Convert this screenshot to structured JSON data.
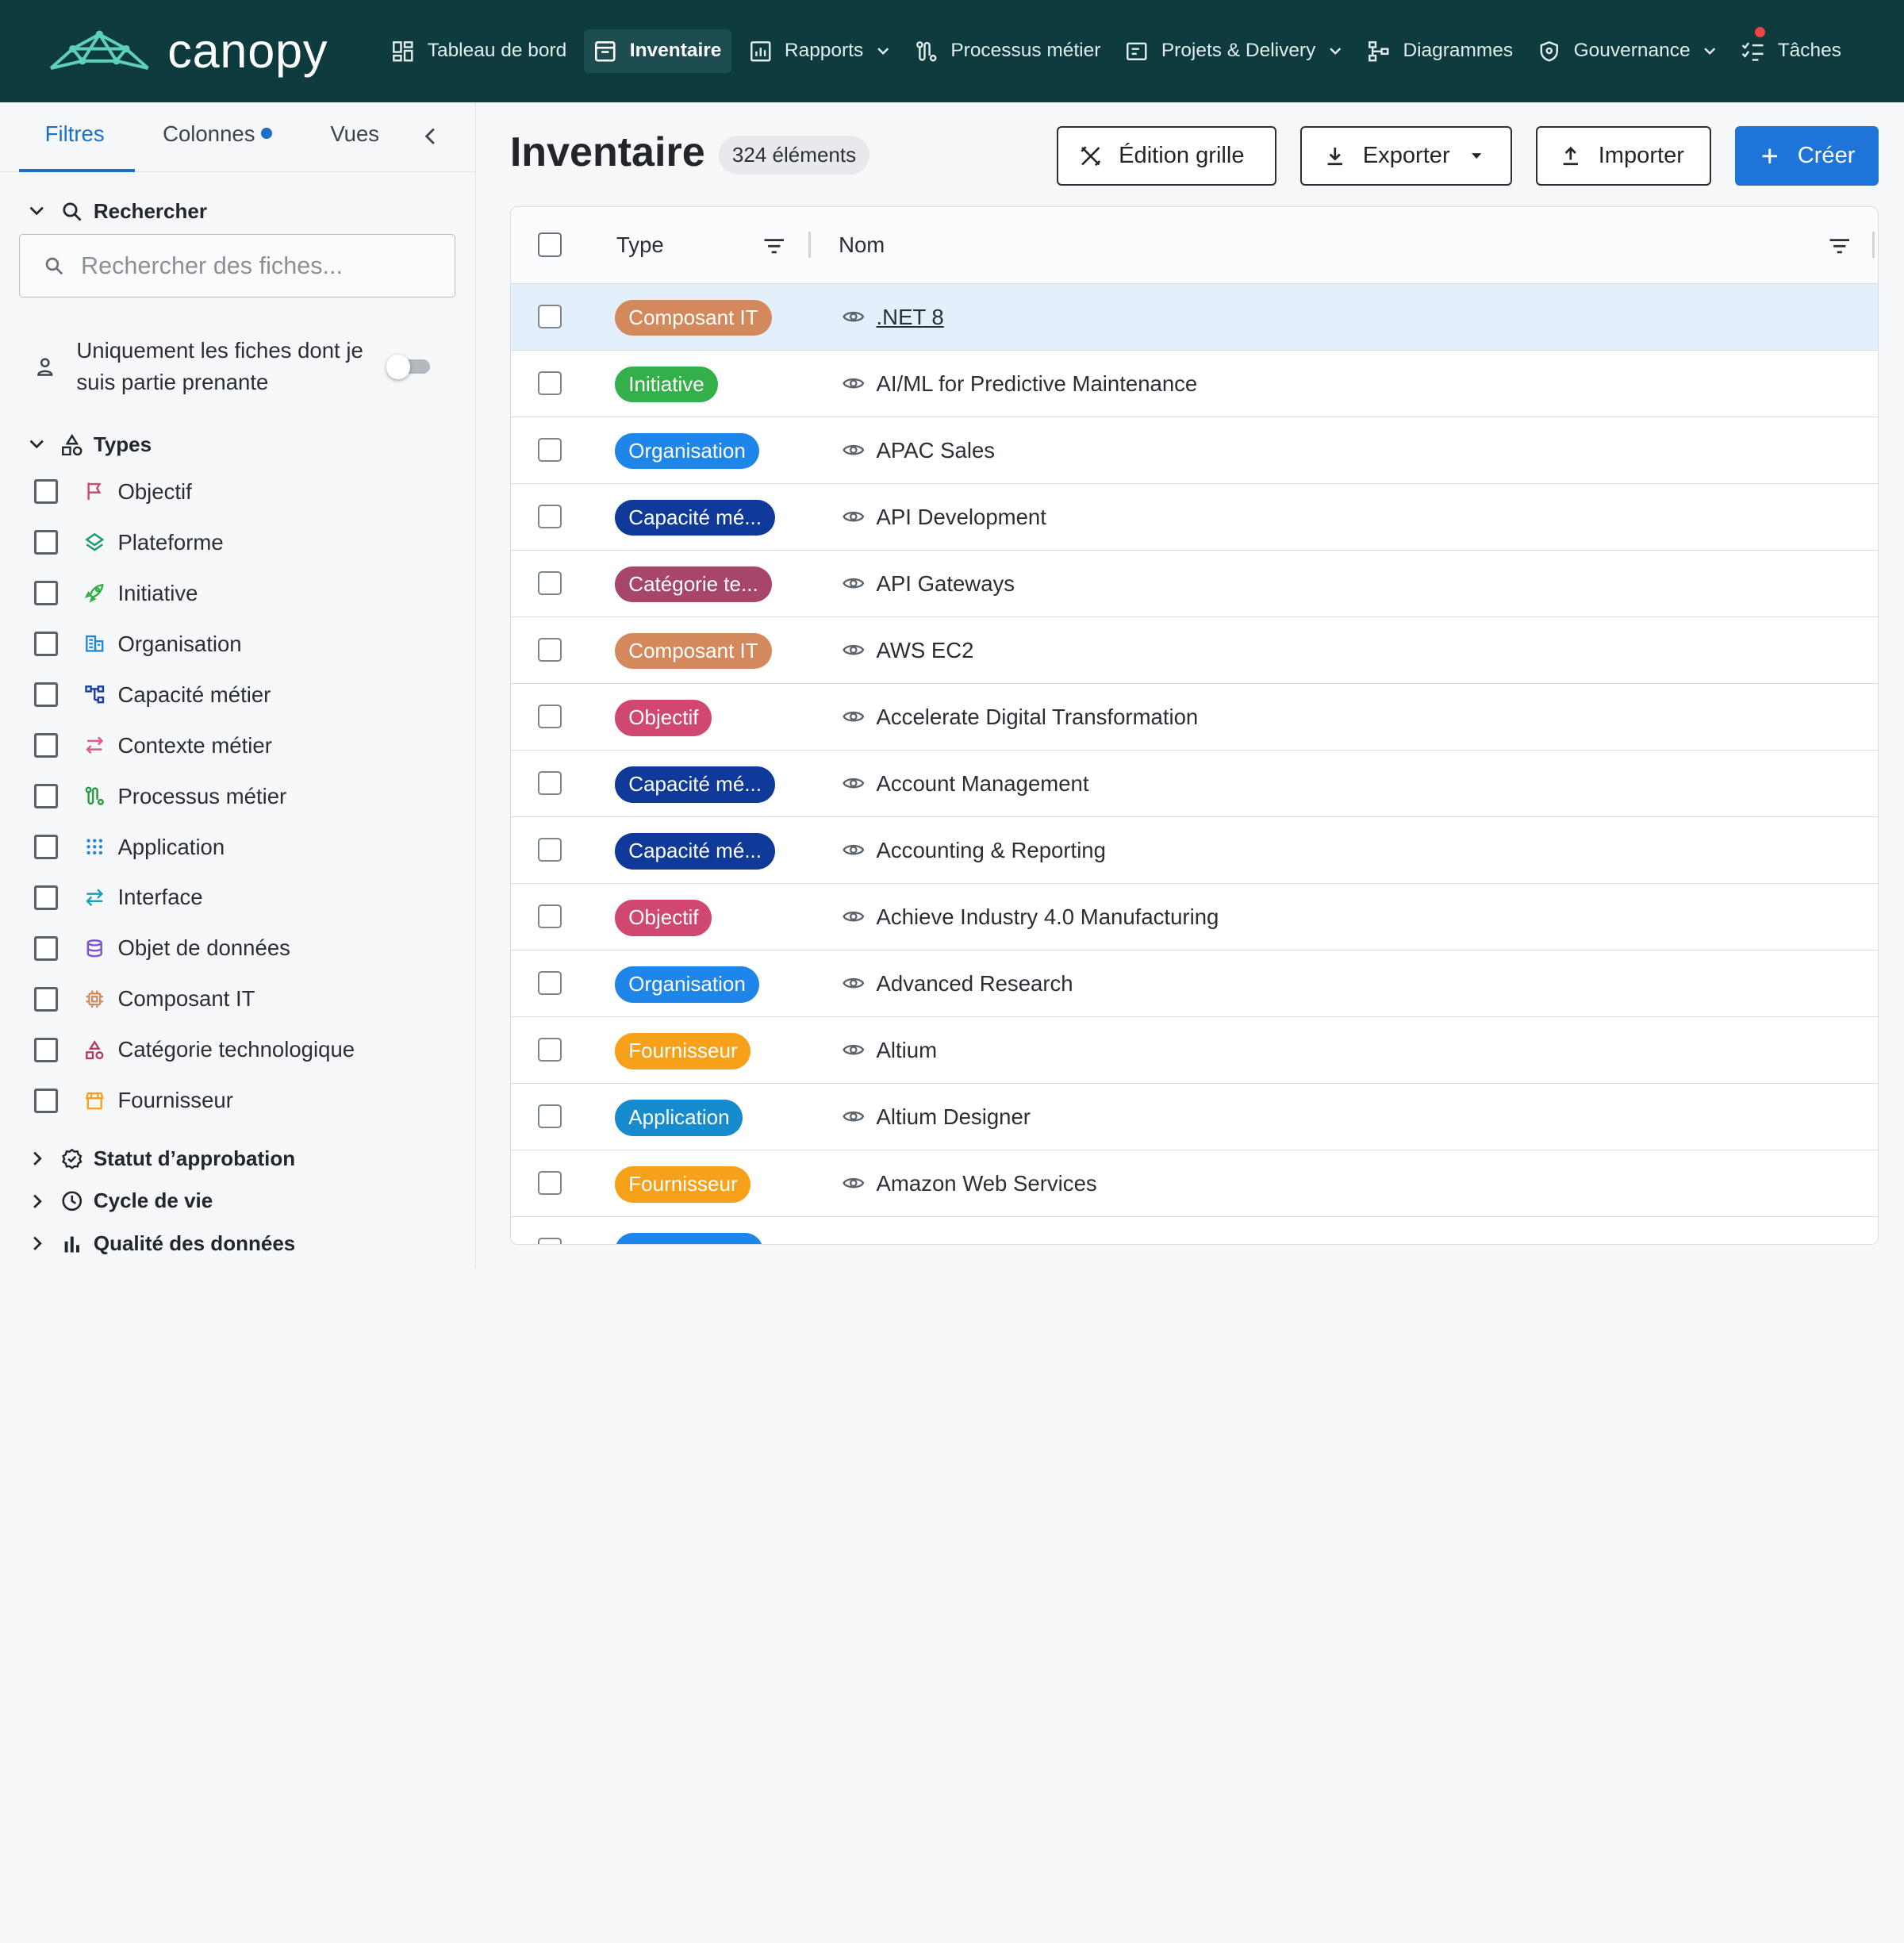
{
  "app": {
    "brand": "canopy",
    "nav": [
      {
        "label": "Tableau de bord",
        "icon": "dashboard-icon",
        "active": false,
        "dropdown": false
      },
      {
        "label": "Inventaire",
        "icon": "inventory-icon",
        "active": true,
        "dropdown": false
      },
      {
        "label": "Rapports",
        "icon": "reports-icon",
        "active": false,
        "dropdown": true
      },
      {
        "label": "Processus métier",
        "icon": "process-icon",
        "active": false,
        "dropdown": false
      },
      {
        "label": "Projets & Delivery",
        "icon": "projects-icon",
        "active": false,
        "dropdown": true
      },
      {
        "label": "Diagrammes",
        "icon": "diagram-icon",
        "active": false,
        "dropdown": false
      },
      {
        "label": "Gouvernance",
        "icon": "shield-icon",
        "active": false,
        "dropdown": true
      },
      {
        "label": "Tâches",
        "icon": "tasks-icon",
        "active": false,
        "dropdown": false,
        "badge": true
      }
    ]
  },
  "sidebar": {
    "tabs": {
      "filters": "Filtres",
      "columns": "Colonnes",
      "views": "Vues"
    },
    "search": {
      "title": "Rechercher",
      "placeholder": "Rechercher des fiches..."
    },
    "stakeholder_only": {
      "label": "Uniquement les fiches dont je suis partie prenante",
      "enabled": false
    },
    "types_title": "Types",
    "types": [
      {
        "label": "Objectif",
        "icon": "flag-icon",
        "color": "#d0486f"
      },
      {
        "label": "Plateforme",
        "icon": "layers-icon",
        "color": "#1f9a6a"
      },
      {
        "label": "Initiative",
        "icon": "rocket-icon",
        "color": "#33b04a"
      },
      {
        "label": "Organisation",
        "icon": "building-icon",
        "color": "#1d86d6"
      },
      {
        "label": "Capacité métier",
        "icon": "hierarchy-icon",
        "color": "#1b3fa0"
      },
      {
        "label": "Contexte métier",
        "icon": "arrows-swap-icon",
        "color": "#e05a8a"
      },
      {
        "label": "Processus métier",
        "icon": "process-icon",
        "color": "#2a9a47"
      },
      {
        "label": "Application",
        "icon": "grid-dots-icon",
        "color": "#1d86d6"
      },
      {
        "label": "Interface",
        "icon": "transfer-icon",
        "color": "#17a2b8"
      },
      {
        "label": "Objet de données",
        "icon": "database-icon",
        "color": "#7b55c9"
      },
      {
        "label": "Composant IT",
        "icon": "chip-icon",
        "color": "#d4895c"
      },
      {
        "label": "Catégorie technologique",
        "icon": "shapes-icon",
        "color": "#b03a5b"
      },
      {
        "label": "Fournisseur",
        "icon": "store-icon",
        "color": "#f4a21a"
      }
    ],
    "sections": [
      {
        "label": "Statut d’approbation",
        "icon": "approval-icon"
      },
      {
        "label": "Cycle de vie",
        "icon": "clock-icon"
      },
      {
        "label": "Qualité des données",
        "icon": "bar-chart-icon"
      }
    ]
  },
  "main": {
    "title": "Inventaire",
    "count": "324 éléments",
    "buttons": {
      "grid_edit": "Édition grille",
      "export": "Exporter",
      "import": "Importer",
      "create": "Créer"
    },
    "columns": {
      "type": "Type",
      "name": "Nom"
    },
    "rows": [
      {
        "type": "Composant IT",
        "color": "#d4895c",
        "name": ".NET 8",
        "selected": true
      },
      {
        "type": "Initiative",
        "color": "#33b04a",
        "name": "AI/ML for Predictive Maintenance"
      },
      {
        "type": "Organisation",
        "color": "#1d86e8",
        "name": "APAC Sales"
      },
      {
        "type": "Capacité mé...",
        "color": "#0f3a9a",
        "name": "API Development"
      },
      {
        "type": "Catégorie te...",
        "color": "#a8456a",
        "name": "API Gateways"
      },
      {
        "type": "Composant IT",
        "color": "#d4895c",
        "name": "AWS EC2"
      },
      {
        "type": "Objectif",
        "color": "#d0486f",
        "name": "Accelerate Digital Transformation"
      },
      {
        "type": "Capacité mé...",
        "color": "#0f3a9a",
        "name": "Account Management"
      },
      {
        "type": "Capacité mé...",
        "color": "#0f3a9a",
        "name": "Accounting & Reporting"
      },
      {
        "type": "Objectif",
        "color": "#d0486f",
        "name": "Achieve Industry 4.0 Manufacturing"
      },
      {
        "type": "Organisation",
        "color": "#1d86e8",
        "name": "Advanced Research"
      },
      {
        "type": "Fournisseur",
        "color": "#f7a019",
        "name": "Altium"
      },
      {
        "type": "Application",
        "color": "#168ccf",
        "name": "Altium Designer"
      },
      {
        "type": "Fournisseur",
        "color": "#f7a019",
        "name": "Amazon Web Services"
      }
    ]
  }
}
